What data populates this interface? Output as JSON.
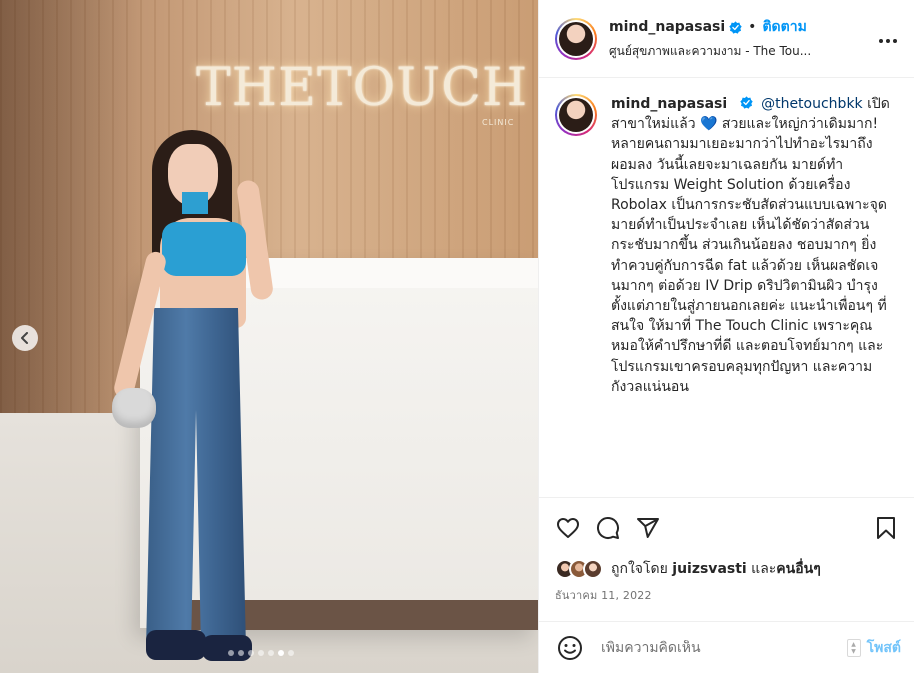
{
  "header": {
    "username": "mind_napasasi",
    "separator": "•",
    "follow_label": "ติดตาม",
    "location": "ศูนย์สุขภาพและความงาม - The Tou...",
    "more_icon": "more-horizontal-icon"
  },
  "photo": {
    "sign_main": "THETOUCH",
    "sign_sub": "CLINIC",
    "prev_icon": "chevron-left-icon",
    "carousel_total": 7,
    "carousel_active": 6
  },
  "caption": {
    "username": "mind_napasasi",
    "mention": "@thetouchbkk",
    "text": "เปิดสาขาใหม่แล้ว 💙 สวยและใหญ่กว่าเดิมมาก! หลายคนถามมาเยอะมากว่าไปทำอะไรมาถึงผอมลง วันนี้เลยจะมาเฉลยกัน มายด์ทำโปรแกรม Weight Solution ด้วยเครื่อง Robolax เป็นการกระชับสัดส่วนแบบเฉพาะจุด มายด์ทำเป็นประจำเลย เห็นได้ชัดว่าสัดส่วนกระชับมากขึ้น ส่วนเกินน้อยลง ชอบมากๆ ยิ่งทำควบคู่กับการฉีด fat แล้วด้วย เห็นผลชัดเจนมากๆ ต่อด้วย IV Drip ดริปวิตามินผิว บำรุงตั้งแต่ภายในสู่ภายนอกเลยค่ะ แนะนำเพื่อนๆ ที่สนใจ ให้มาที่ The Touch Clinic เพราะคุณหมอให้คำปรึกษาที่ดี และตอบโจทย์มากๆ และโปรแกรมเขาครอบคลุมทุกปัญหา และความกังวลแน่นอน"
  },
  "actions": {
    "like_icon": "heart-icon",
    "comment_icon": "comment-icon",
    "share_icon": "share-icon",
    "save_icon": "bookmark-icon"
  },
  "likes": {
    "prefix": "ถูกใจโดย",
    "user": "juizsvasti",
    "and": "และ",
    "others": "คนอื่นๆ"
  },
  "date": "ธันวาคม 11, 2022",
  "comment": {
    "emoji_icon": "smiley-icon",
    "placeholder": "เพิ่มความคิดเห็น",
    "post_label": "โพสต์"
  },
  "colors": {
    "accent": "#0095f6",
    "mention": "#00376b",
    "text": "#262626",
    "muted": "#737373"
  }
}
